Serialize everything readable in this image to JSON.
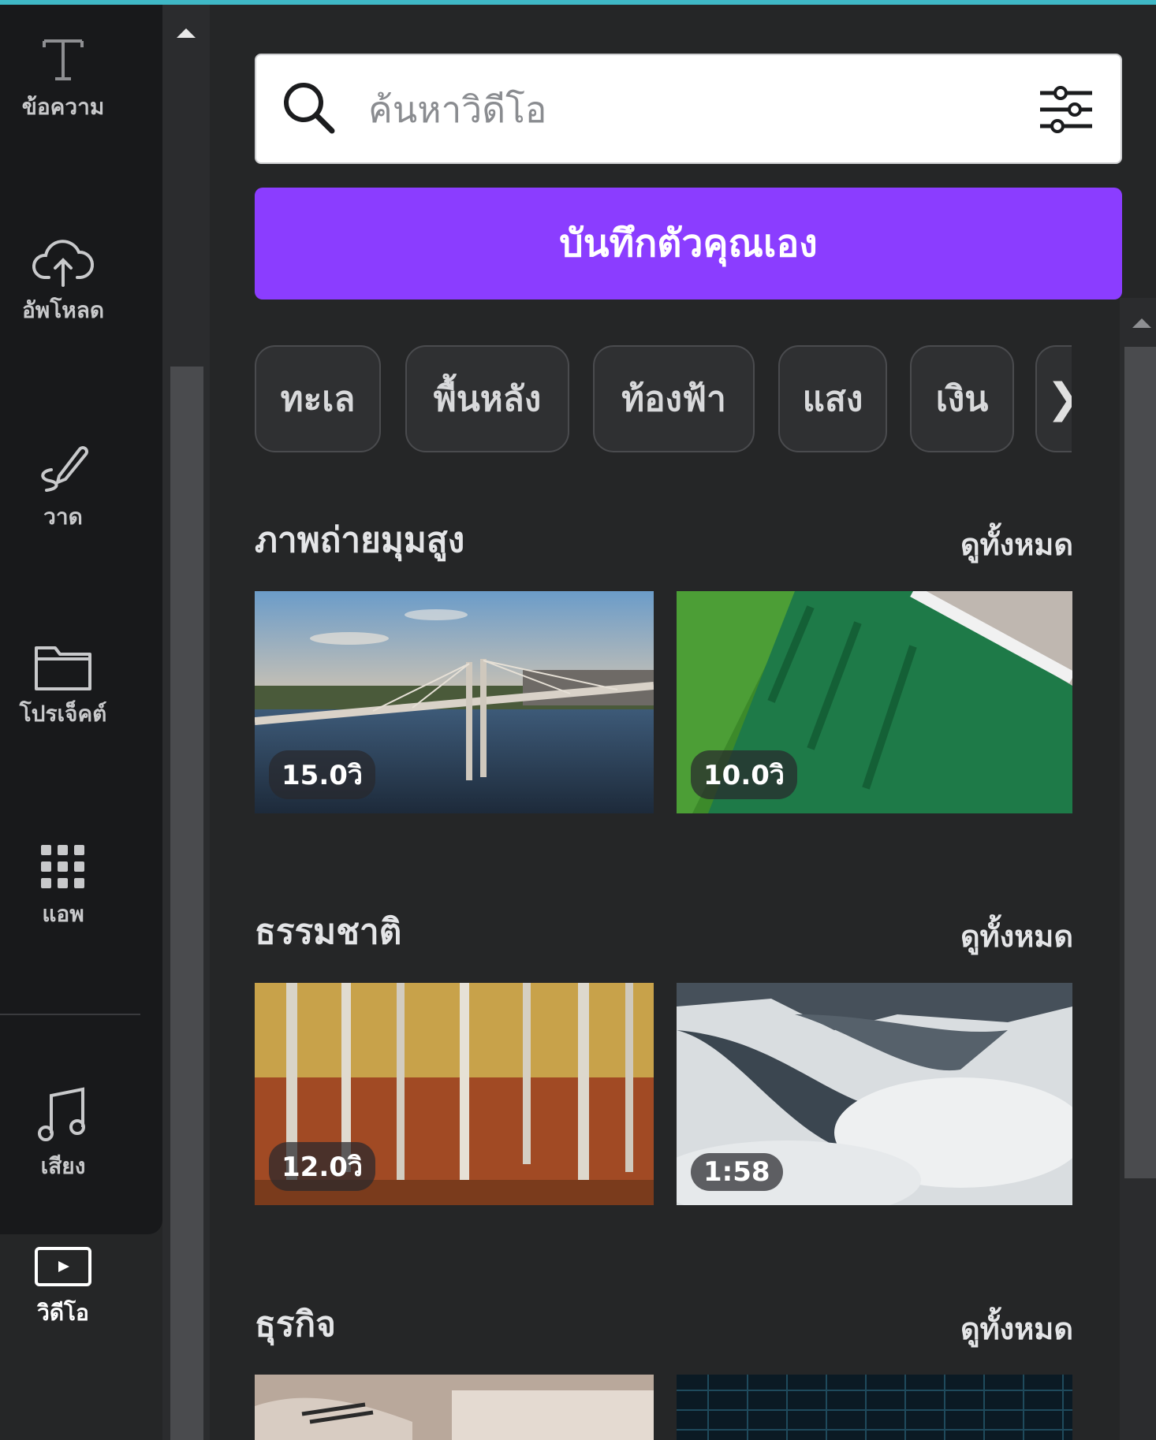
{
  "nav": {
    "items": [
      {
        "label": "ข้อความ",
        "icon": "text-icon"
      },
      {
        "label": "อัพโหลด",
        "icon": "cloud-upload-icon"
      },
      {
        "label": "วาด",
        "icon": "draw-pen-icon"
      },
      {
        "label": "โปรเจ็คต์",
        "icon": "folder-icon"
      },
      {
        "label": "แอพ",
        "icon": "apps-grid-icon"
      },
      {
        "label": "เสียง",
        "icon": "music-note-icon"
      }
    ],
    "active": {
      "label": "วิดีโอ",
      "icon": "video-icon"
    }
  },
  "search": {
    "placeholder": "ค้นหาวิดีโอ"
  },
  "record_button": {
    "label": "บันทึกตัวคุณเอง"
  },
  "chips": [
    "ทะเล",
    "พื้นหลัง",
    "ท้องฟ้า",
    "แสง",
    "เงิน"
  ],
  "sections": [
    {
      "title": "ภาพถ่ายมุมสูง",
      "see_all": "ดูทั้งหมด",
      "videos": [
        {
          "duration": "15.0วิ"
        },
        {
          "duration": "10.0วิ"
        }
      ]
    },
    {
      "title": "ธรรมชาติ",
      "see_all": "ดูทั้งหมด",
      "videos": [
        {
          "duration": "12.0วิ"
        },
        {
          "duration": "1:58"
        }
      ]
    },
    {
      "title": "ธุรกิจ",
      "see_all": "ดูทั้งหมด",
      "videos": [
        {
          "duration": ""
        },
        {
          "duration": ""
        }
      ]
    }
  ],
  "colors": {
    "accent": "#8b3dff",
    "background": "#252627",
    "sidebar": "#18191b"
  }
}
